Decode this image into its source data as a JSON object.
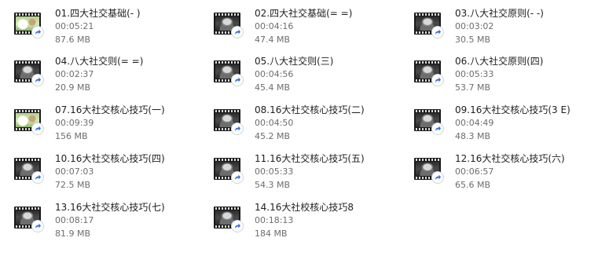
{
  "files": [
    {
      "name": "01.四大社交基础(- )",
      "duration": "00:05:21",
      "size": "87.6 MB",
      "thumb": "cartoon"
    },
    {
      "name": "02.四大社交基础(= =)",
      "duration": "00:04:16",
      "size": "47.4 MB",
      "thumb": "dark"
    },
    {
      "name": "03.八大社交原则(- -)",
      "duration": "00:03:02",
      "size": "30.5 MB",
      "thumb": "dark"
    },
    {
      "name": "04.八大社交则(= =)",
      "duration": "00:02:37",
      "size": "20.9 MB",
      "thumb": "dark"
    },
    {
      "name": "05.八大社交则(三)",
      "duration": "00:04:56",
      "size": "45.4 MB",
      "thumb": "dark"
    },
    {
      "name": "06.八大社交原则(四)",
      "duration": "00:05:33",
      "size": "53.7 MB",
      "thumb": "dark"
    },
    {
      "name": "07.16大社交核心技巧(一)",
      "duration": "00:09:39",
      "size": "156 MB",
      "thumb": "cartoon"
    },
    {
      "name": "08.16大社交核心技巧(二)",
      "duration": "00:04:50",
      "size": "45.2 MB",
      "thumb": "dark"
    },
    {
      "name": "09.16大社交核心技巧(3 E)",
      "duration": "00:04:49",
      "size": "48.3 MB",
      "thumb": "dark"
    },
    {
      "name": "10.16大社交核心技巧(四)",
      "duration": "00:07:03",
      "size": "72.5 MB",
      "thumb": "dark"
    },
    {
      "name": "11.16大社交核心技巧(五)",
      "duration": "00:05:33",
      "size": "54.3 MB",
      "thumb": "dark"
    },
    {
      "name": "12.16大社交核心技巧(六)",
      "duration": "00:06:57",
      "size": "65.6 MB",
      "thumb": "dark"
    },
    {
      "name": "13.16大社交核心技巧(七)",
      "duration": "00:08:17",
      "size": "81.9 MB",
      "thumb": "dark"
    },
    {
      "name": "14.16大社校核心技巧8",
      "duration": "00:18:13",
      "size": "184 MB",
      "thumb": "dark"
    }
  ],
  "icons": {
    "thumbnail": "video-thumbnail-icon",
    "overlay": "shortcut-arrow-icon"
  },
  "colors": {
    "name_text": "#1e1e1e",
    "meta_text": "#6d6d6d",
    "shortcut_arrow": "#2f6fd6"
  }
}
